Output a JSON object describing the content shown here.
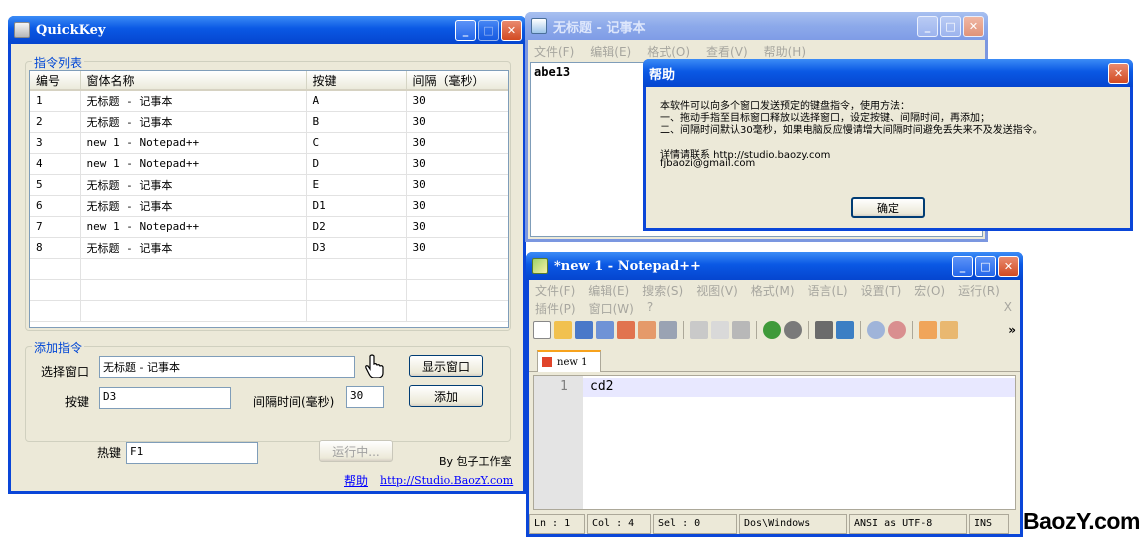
{
  "quickkey": {
    "title": "QuickKey",
    "btn_min": "_",
    "btn_max": "□",
    "btn_close": "✕",
    "group_list": "指令列表",
    "columns": [
      "编号",
      "窗体名称",
      "按键",
      "间隔（毫秒）"
    ],
    "rows": [
      [
        "1",
        "无标题 - 记事本",
        "A",
        "30"
      ],
      [
        "2",
        "无标题 - 记事本",
        "B",
        "30"
      ],
      [
        "3",
        "new  1 - Notepad++",
        "C",
        "30"
      ],
      [
        "4",
        "new  1 - Notepad++",
        "D",
        "30"
      ],
      [
        "5",
        "无标题 - 记事本",
        "E",
        "30"
      ],
      [
        "6",
        "无标题 - 记事本",
        "D1",
        "30"
      ],
      [
        "7",
        "new  1 - Notepad++",
        "D2",
        "30"
      ],
      [
        "8",
        "无标题 - 记事本",
        "D3",
        "30"
      ]
    ],
    "group_add": "添加指令",
    "label_window": "选择窗口",
    "window_value": "无标题 - 记事本",
    "show_window_button": "显示窗口",
    "label_key": "按键",
    "key_value": "D3",
    "label_interval": "间隔时间(毫秒)",
    "interval_value": "30",
    "add_button": "添加",
    "label_hotkey": "热键",
    "hotkey_value": "F1",
    "running_button": "运行中...",
    "credit": "By 包子工作室",
    "help_link": "帮助",
    "site_link": "http://Studio.BaozY.com"
  },
  "notepad": {
    "title": "无标题 - 记事本",
    "menu": [
      "文件(F)",
      "编辑(E)",
      "格式(O)",
      "查看(V)",
      "帮助(H)"
    ],
    "content": "abe13"
  },
  "help_dialog": {
    "title": "帮助",
    "line1": "本软件可以向多个窗口发送预定的键盘指令，使用方法：",
    "line2": "一、拖动手指至目标窗口释放以选择窗口，设定按键、间隔时间，再添加；",
    "line3": "二、间隔时间默认30毫秒，如果电脑反应慢请增大间隔时间避免丢失来不及发送指令。",
    "line4": "详情请联系 http://studio.baozy.com",
    "line5": "fjbaozi@gmail.com",
    "ok_button": "确定"
  },
  "npp": {
    "title": "*new  1 - Notepad++",
    "menu_row1": [
      "文件(F)",
      "编辑(E)",
      "搜索(S)",
      "视图(V)",
      "格式(M)",
      "语言(L)",
      "设置(T)",
      "宏(O)",
      "运行(R)"
    ],
    "menu_row2": [
      "插件(P)",
      "窗口(W)",
      "?"
    ],
    "menu_close": "X",
    "toolbar_more": "»",
    "tab_label": "new  1",
    "line_number": "1",
    "code_line": "cd2",
    "status": [
      "Ln : 1",
      "Col : 4",
      "Sel : 0",
      "Dos\\Windows",
      "ANSI as UTF-8",
      "INS"
    ]
  },
  "watermark": "BaozY.com"
}
